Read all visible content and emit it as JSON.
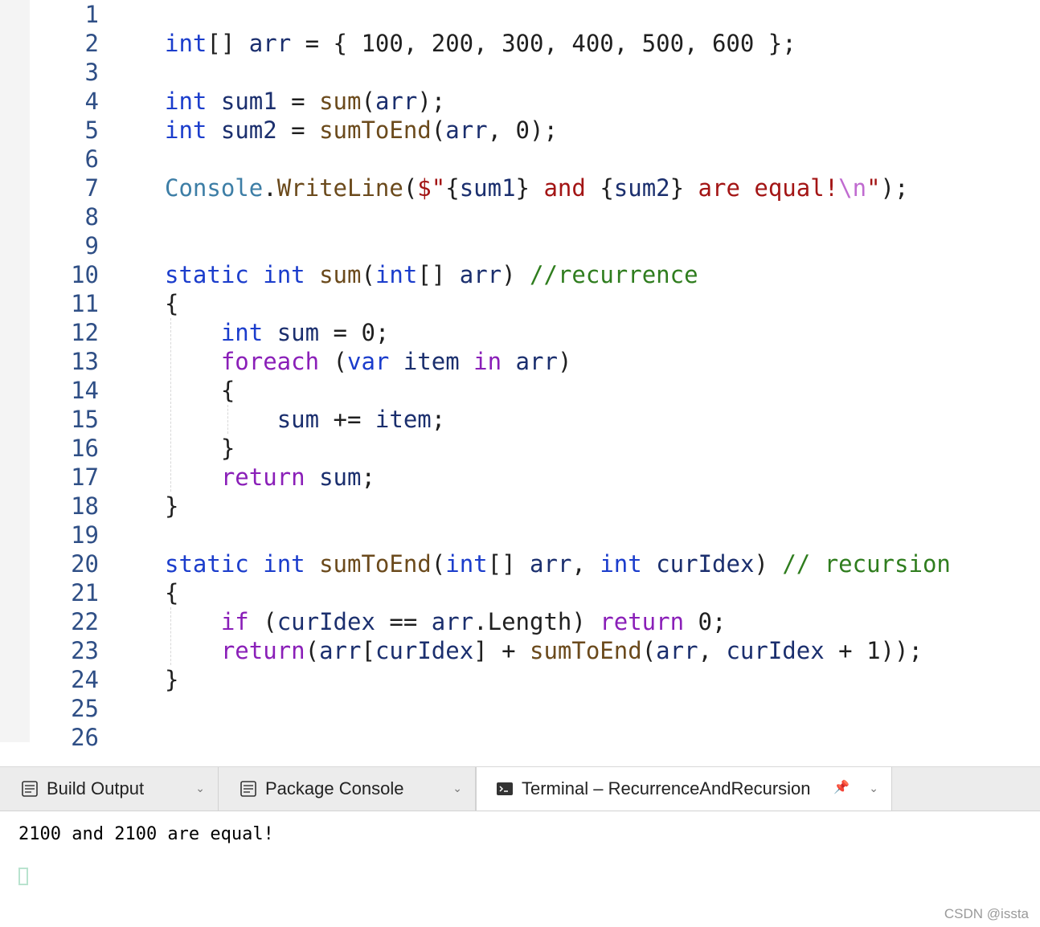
{
  "colors": {
    "keyword": "#1b3dcc",
    "control": "#8a1fb8",
    "identifier": "#1b2f6e",
    "method": "#6b4a1c",
    "type": "#3d7ea6",
    "string": "#a31515",
    "interp": "#1b2f6e",
    "comment": "#2f7d1e",
    "punct": "#1f1f1f",
    "escape": "#c06bd0",
    "number": "#1f1f1f"
  },
  "editor": {
    "line_numbers": [
      "1",
      "2",
      "3",
      "4",
      "5",
      "6",
      "7",
      "8",
      "9",
      "10",
      "11",
      "12",
      "13",
      "14",
      "15",
      "16",
      "17",
      "18",
      "19",
      "20",
      "21",
      "22",
      "23",
      "24",
      "25",
      "26"
    ],
    "lines": [
      [],
      [
        [
          "keyword",
          "int"
        ],
        [
          "punct",
          "[] "
        ],
        [
          "identifier",
          "arr"
        ],
        [
          "punct",
          " = { 100, 200, 300, 400, 500, 600 };"
        ]
      ],
      [],
      [
        [
          "keyword",
          "int"
        ],
        [
          "punct",
          " "
        ],
        [
          "identifier",
          "sum1"
        ],
        [
          "punct",
          " = "
        ],
        [
          "method",
          "sum"
        ],
        [
          "punct",
          "("
        ],
        [
          "identifier",
          "arr"
        ],
        [
          "punct",
          ");"
        ]
      ],
      [
        [
          "keyword",
          "int"
        ],
        [
          "punct",
          " "
        ],
        [
          "identifier",
          "sum2"
        ],
        [
          "punct",
          " = "
        ],
        [
          "method",
          "sumToEnd"
        ],
        [
          "punct",
          "("
        ],
        [
          "identifier",
          "arr"
        ],
        [
          "punct",
          ", 0);"
        ]
      ],
      [],
      [
        [
          "type",
          "Console"
        ],
        [
          "punct",
          "."
        ],
        [
          "method",
          "WriteLine"
        ],
        [
          "punct",
          "("
        ],
        [
          "string",
          "$\""
        ],
        [
          "punct",
          "{"
        ],
        [
          "interp",
          "sum1"
        ],
        [
          "punct",
          "}"
        ],
        [
          "string",
          " and "
        ],
        [
          "punct",
          "{"
        ],
        [
          "interp",
          "sum2"
        ],
        [
          "punct",
          "}"
        ],
        [
          "string",
          " are equal!"
        ],
        [
          "escape",
          "\\n"
        ],
        [
          "string",
          "\""
        ],
        [
          "punct",
          ");"
        ]
      ],
      [],
      [],
      [
        [
          "keyword",
          "static"
        ],
        [
          "punct",
          " "
        ],
        [
          "keyword",
          "int"
        ],
        [
          "punct",
          " "
        ],
        [
          "method",
          "sum"
        ],
        [
          "punct",
          "("
        ],
        [
          "keyword",
          "int"
        ],
        [
          "punct",
          "[] "
        ],
        [
          "identifier",
          "arr"
        ],
        [
          "punct",
          ") "
        ],
        [
          "comment",
          "//recurrence"
        ]
      ],
      [
        [
          "punct",
          "{"
        ]
      ],
      [
        [
          "punct",
          "    "
        ],
        [
          "keyword",
          "int"
        ],
        [
          "punct",
          " "
        ],
        [
          "identifier",
          "sum"
        ],
        [
          "punct",
          " = 0;"
        ]
      ],
      [
        [
          "punct",
          "    "
        ],
        [
          "control",
          "foreach"
        ],
        [
          "punct",
          " ("
        ],
        [
          "keyword",
          "var"
        ],
        [
          "punct",
          " "
        ],
        [
          "identifier",
          "item"
        ],
        [
          "punct",
          " "
        ],
        [
          "control",
          "in"
        ],
        [
          "punct",
          " "
        ],
        [
          "identifier",
          "arr"
        ],
        [
          "punct",
          ")"
        ]
      ],
      [
        [
          "punct",
          "    {"
        ]
      ],
      [
        [
          "punct",
          "        "
        ],
        [
          "identifier",
          "sum"
        ],
        [
          "punct",
          " += "
        ],
        [
          "identifier",
          "item"
        ],
        [
          "punct",
          ";"
        ]
      ],
      [
        [
          "punct",
          "    }"
        ]
      ],
      [
        [
          "punct",
          "    "
        ],
        [
          "control",
          "return"
        ],
        [
          "punct",
          " "
        ],
        [
          "identifier",
          "sum"
        ],
        [
          "punct",
          ";"
        ]
      ],
      [
        [
          "punct",
          "}"
        ]
      ],
      [],
      [
        [
          "keyword",
          "static"
        ],
        [
          "punct",
          " "
        ],
        [
          "keyword",
          "int"
        ],
        [
          "punct",
          " "
        ],
        [
          "method",
          "sumToEnd"
        ],
        [
          "punct",
          "("
        ],
        [
          "keyword",
          "int"
        ],
        [
          "punct",
          "[] "
        ],
        [
          "identifier",
          "arr"
        ],
        [
          "punct",
          ", "
        ],
        [
          "keyword",
          "int"
        ],
        [
          "punct",
          " "
        ],
        [
          "identifier",
          "curIdex"
        ],
        [
          "punct",
          ") "
        ],
        [
          "comment",
          "// recursion"
        ]
      ],
      [
        [
          "punct",
          "{"
        ]
      ],
      [
        [
          "punct",
          "    "
        ],
        [
          "control",
          "if"
        ],
        [
          "punct",
          " ("
        ],
        [
          "identifier",
          "curIdex"
        ],
        [
          "punct",
          " == "
        ],
        [
          "identifier",
          "arr"
        ],
        [
          "punct",
          "."
        ],
        [
          "punct",
          "Length) "
        ],
        [
          "control",
          "return"
        ],
        [
          "punct",
          " 0;"
        ]
      ],
      [
        [
          "punct",
          "    "
        ],
        [
          "control",
          "return"
        ],
        [
          "punct",
          "("
        ],
        [
          "identifier",
          "arr"
        ],
        [
          "punct",
          "["
        ],
        [
          "identifier",
          "curIdex"
        ],
        [
          "punct",
          "] + "
        ],
        [
          "method",
          "sumToEnd"
        ],
        [
          "punct",
          "("
        ],
        [
          "identifier",
          "arr"
        ],
        [
          "punct",
          ", "
        ],
        [
          "identifier",
          "curIdex"
        ],
        [
          "punct",
          " + 1));"
        ]
      ],
      [
        [
          "punct",
          "}"
        ]
      ],
      [],
      []
    ]
  },
  "panel": {
    "tabs": [
      {
        "label": "Build Output",
        "icon": "build-output-icon",
        "active": false
      },
      {
        "label": "Package Console",
        "icon": "package-console-icon",
        "active": false
      },
      {
        "label": "Terminal – RecurrenceAndRecursion",
        "icon": "terminal-icon",
        "active": true
      }
    ],
    "terminal_output": "2100 and 2100 are equal!"
  },
  "watermark": "CSDN @issta"
}
